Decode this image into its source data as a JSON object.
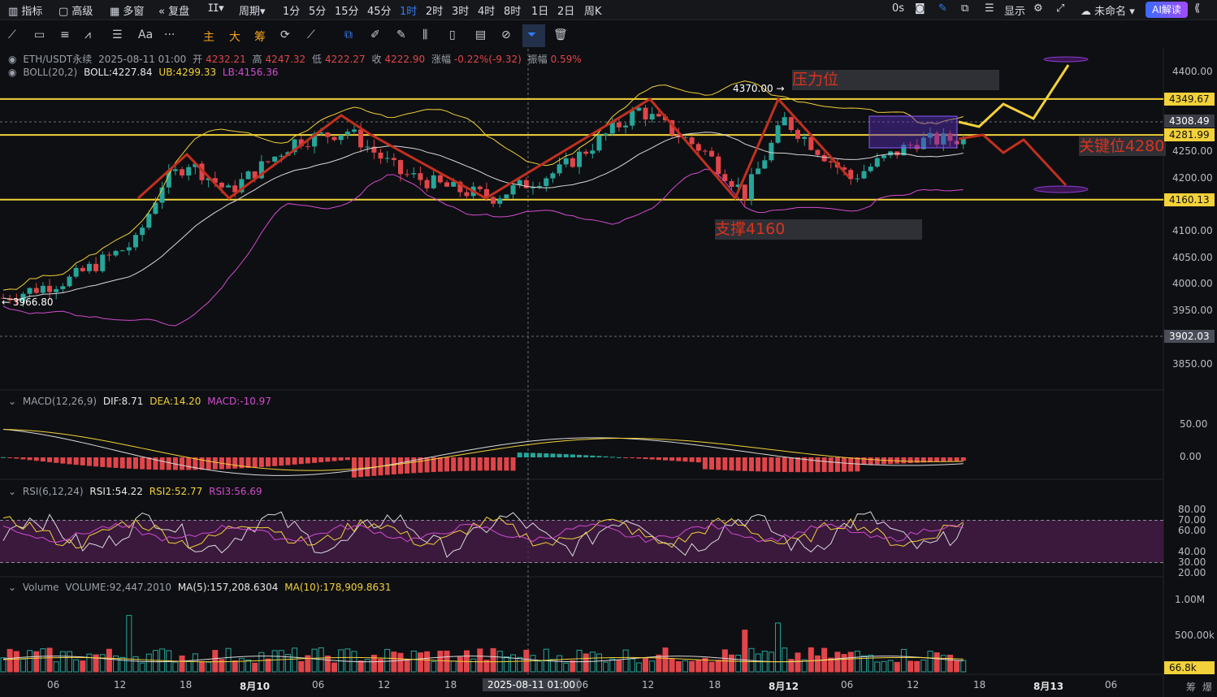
{
  "toolbar": {
    "items": [
      "指标",
      "高级",
      "多窗",
      "复盘",
      "",
      "周期",
      "1分",
      "5分",
      "15分",
      "45分",
      "1时",
      "2时",
      "3时",
      "4时",
      "8时",
      "1日",
      "2日",
      "周K"
    ],
    "right_time": "0s",
    "display_label": "显示",
    "layout_name": "未命名",
    "ai_label": "AI解读"
  },
  "drawbar": {
    "main_label": "主",
    "large_label": "大",
    "chip_label": "筹",
    "font_label": "Aa"
  },
  "legend_main": {
    "symbol": "ETH/USDT永续",
    "datetime": "2025-08-11 01:00",
    "open_label": "开",
    "open": "4232.21",
    "high_label": "高",
    "high": "4247.32",
    "low_label": "低",
    "low": "4222.27",
    "close_label": "收",
    "close": "4222.90",
    "change_label": "涨幅",
    "change": "-0.22%(-9.32)",
    "amp_label": "振幅",
    "amp": "0.59%"
  },
  "legend_boll": {
    "name": "BOLL(20,2)",
    "boll": "BOLL:4227.84",
    "ub": "UB:4299.33",
    "lb": "LB:4156.36"
  },
  "legend_macd": {
    "name": "MACD(12,26,9)",
    "dif": "DIF:8.71",
    "dea": "DEA:14.20",
    "macd": "MACD:-10.97"
  },
  "legend_rsi": {
    "name": "RSI(6,12,24)",
    "rsi1": "RSI1:54.22",
    "rsi2": "RSI2:52.77",
    "rsi3": "RSI3:56.69"
  },
  "legend_vol": {
    "name": "Volume",
    "vol": "VOLUME:92,447.2010",
    "ma5": "MA(5):157,208.6304",
    "ma10": "MA(10):178,909.8631"
  },
  "annotations": {
    "high_marker": "4370.00 →",
    "low_marker": "← 3966.80",
    "resistance": "压力位",
    "key_level": "关键位4280",
    "support": "支撑4160"
  },
  "price_axis": [
    "4400.00",
    "4250.00",
    "4200.00",
    "4100.00",
    "4050.00",
    "4000.00",
    "3950.00",
    "3850.00"
  ],
  "price_tags": [
    {
      "v": "4349.67",
      "bg": "#f2d13a",
      "fg": "#111"
    },
    {
      "v": "4308.49",
      "bg": "#3a3d45",
      "fg": "#fff"
    },
    {
      "v": "4281.99",
      "bg": "#f2d13a",
      "fg": "#111"
    },
    {
      "v": "4160.13",
      "bg": "#f2d13a",
      "fg": "#111"
    },
    {
      "v": "3902.03",
      "bg": "#4a4e58",
      "fg": "#fff"
    }
  ],
  "macd_axis": [
    "50.00",
    "0.00"
  ],
  "rsi_axis": [
    "80.00",
    "70.00",
    "60.00",
    "40.00",
    "30.00",
    "20.00"
  ],
  "vol_axis": [
    "1.00M",
    "500.00k"
  ],
  "vol_tag": "66.8k",
  "time_axis": [
    "06",
    "12",
    "18",
    "8月10",
    "06",
    "12",
    "18",
    "2025-08-11 01:00",
    "06",
    "12",
    "18",
    "8月12",
    "06",
    "12",
    "18",
    "8月13",
    "06"
  ],
  "corner_labels": {
    "a": "筹",
    "b": "爆"
  },
  "colors": {
    "up": "#26a69a",
    "down": "#e0454a",
    "yellow": "#f2d13a",
    "pink": "#d24bd0",
    "drawing": "#c0301f"
  }
}
